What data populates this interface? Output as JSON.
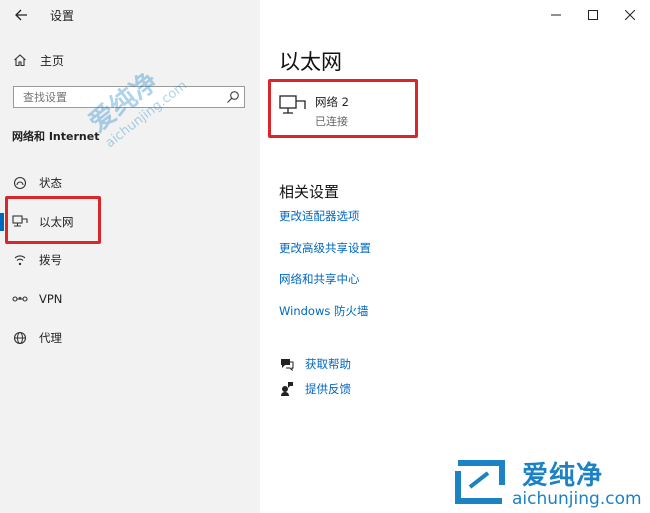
{
  "app": {
    "title": "设置"
  },
  "sidebar": {
    "home_label": "主页",
    "search_placeholder": "查找设置",
    "section_label": "网络和 Internet",
    "items": [
      {
        "label": "状态",
        "icon": "status-icon"
      },
      {
        "label": "以太网",
        "icon": "ethernet-icon",
        "selected": true
      },
      {
        "label": "拨号",
        "icon": "dialup-icon"
      },
      {
        "label": "VPN",
        "icon": "vpn-icon"
      },
      {
        "label": "代理",
        "icon": "proxy-icon"
      }
    ]
  },
  "main": {
    "title": "以太网",
    "network": {
      "name": "网络 2",
      "status": "已连接",
      "icon": "ethernet-icon"
    },
    "related_title": "相关设置",
    "links": [
      "更改适配器选项",
      "更改高级共享设置",
      "网络和共享中心",
      "Windows 防火墙"
    ],
    "help": [
      {
        "label": "获取帮助",
        "icon": "help-icon"
      },
      {
        "label": "提供反馈",
        "icon": "feedback-icon"
      }
    ]
  },
  "watermark": {
    "brand": "爱纯净",
    "url": "aichunjing.com"
  },
  "colors": {
    "accent": "#0067c0",
    "highlight_box": "#d8262a",
    "sidebar_bg": "#f2f2f2",
    "watermark": "#1c82c6"
  }
}
